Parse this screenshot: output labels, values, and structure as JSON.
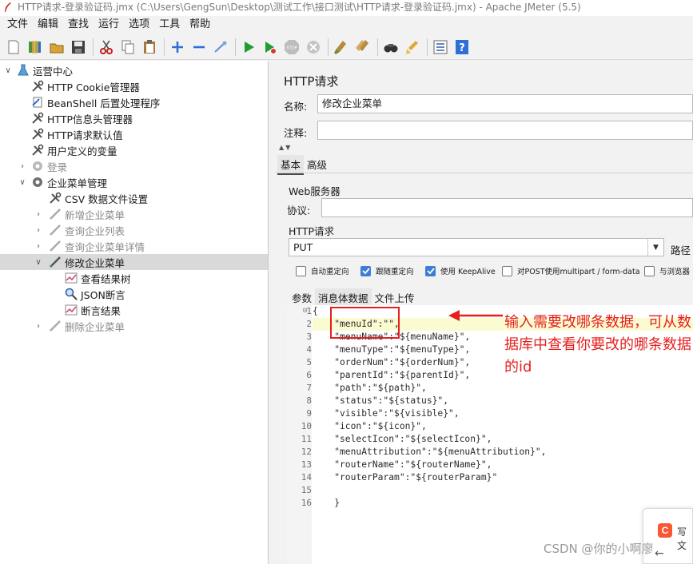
{
  "window": {
    "title": "HTTP请求-登录验证码.jmx (C:\\Users\\GengSun\\Desktop\\测试工作\\接口测试\\HTTP请求-登录验证码.jmx) - Apache JMeter (5.5)"
  },
  "menu": [
    "文件",
    "编辑",
    "查找",
    "运行",
    "选项",
    "工具",
    "帮助"
  ],
  "toolbar": {
    "icons": [
      "new-icon",
      "templates-icon",
      "open-icon",
      "save-icon",
      "cut-icon",
      "copy-icon",
      "paste-icon",
      "expand-icon",
      "collapse-icon",
      "toggle-icon",
      "start-icon",
      "start-no-pause-icon",
      "stop-icon",
      "shutdown-icon",
      "clear-icon",
      "clear-all-icon",
      "search-icon",
      "reset-search-icon",
      "function-helper-icon",
      "help-icon"
    ]
  },
  "tree": {
    "root": "运营中心",
    "items": [
      {
        "label": "HTTP Cookie管理器",
        "icon": "wrench-icon"
      },
      {
        "label": "BeanShell 后置处理程序",
        "icon": "postprocessor-icon"
      },
      {
        "label": "HTTP信息头管理器",
        "icon": "wrench-icon"
      },
      {
        "label": "HTTP请求默认值",
        "icon": "wrench-icon"
      },
      {
        "label": "用户定义的变量",
        "icon": "wrench-icon"
      },
      {
        "label": "登录",
        "icon": "gear-icon"
      },
      {
        "label": "企业菜单管理",
        "icon": "gear-icon"
      },
      {
        "label": "CSV 数据文件设置",
        "icon": "wrench-icon"
      },
      {
        "label": "新增企业菜单",
        "icon": "sampler-icon"
      },
      {
        "label": "查询企业列表",
        "icon": "sampler-icon"
      },
      {
        "label": "查询企业菜单详情",
        "icon": "sampler-icon"
      },
      {
        "label": "修改企业菜单",
        "icon": "sampler-icon"
      },
      {
        "label": "查看结果树",
        "icon": "listener-icon"
      },
      {
        "label": "JSON断言",
        "icon": "magnifier-icon"
      },
      {
        "label": "断言结果",
        "icon": "listener-icon"
      },
      {
        "label": "删除企业菜单",
        "icon": "sampler-icon"
      }
    ]
  },
  "panel": {
    "title": "HTTP请求",
    "name_label": "名称:",
    "name_value": "修改企业菜单",
    "comment_label": "注释:",
    "comment_value": "",
    "tabs": [
      "基本",
      "高级"
    ],
    "web_server_label": "Web服务器",
    "protocol_label": "协议:",
    "protocol_value": "",
    "http_request_label": "HTTP请求",
    "method": "PUT",
    "path_label": "路径",
    "checkboxes": [
      {
        "label": "自动重定向",
        "checked": false
      },
      {
        "label": "跟随重定向",
        "checked": true
      },
      {
        "label": "使用 KeepAlive",
        "checked": true
      },
      {
        "label": "对POST使用multipart / form-data",
        "checked": false
      },
      {
        "label": "与浏览器",
        "checked": false
      }
    ],
    "body_tabs": [
      "参数",
      "消息体数据",
      "文件上传"
    ]
  },
  "editor": {
    "lines": [
      "{",
      "    \"menuId\":\"\",",
      "    \"menuName\":\"${menuName}\",",
      "    \"menuType\":\"${menuType}\",",
      "    \"orderNum\":\"${orderNum}\",",
      "    \"parentId\":\"${parentId}\",",
      "    \"path\":\"${path}\",",
      "    \"status\":\"${status}\",",
      "    \"visible\":\"${visible}\",",
      "    \"icon\":\"${icon}\",",
      "    \"selectIcon\":\"${selectIcon}\",",
      "    \"menuAttribution\":\"${menuAttribution}\",",
      "    \"routerName\":\"${routerName}\",",
      "    \"routerParam\":\"${routerParam}\"",
      "",
      "    }"
    ],
    "line_numbers": [
      "1",
      "2",
      "3",
      "4",
      "5",
      "6",
      "7",
      "8",
      "9",
      "10",
      "11",
      "12",
      "13",
      "14",
      "15",
      "16"
    ]
  },
  "annotation": {
    "text": "输入需要改哪条数据，可从数据库中查看你要改的哪条数据的id",
    "color": "#e61e1e"
  },
  "popup": {
    "logo": "C",
    "text": "写文"
  },
  "watermark": "CSDN @你的小啊廖"
}
